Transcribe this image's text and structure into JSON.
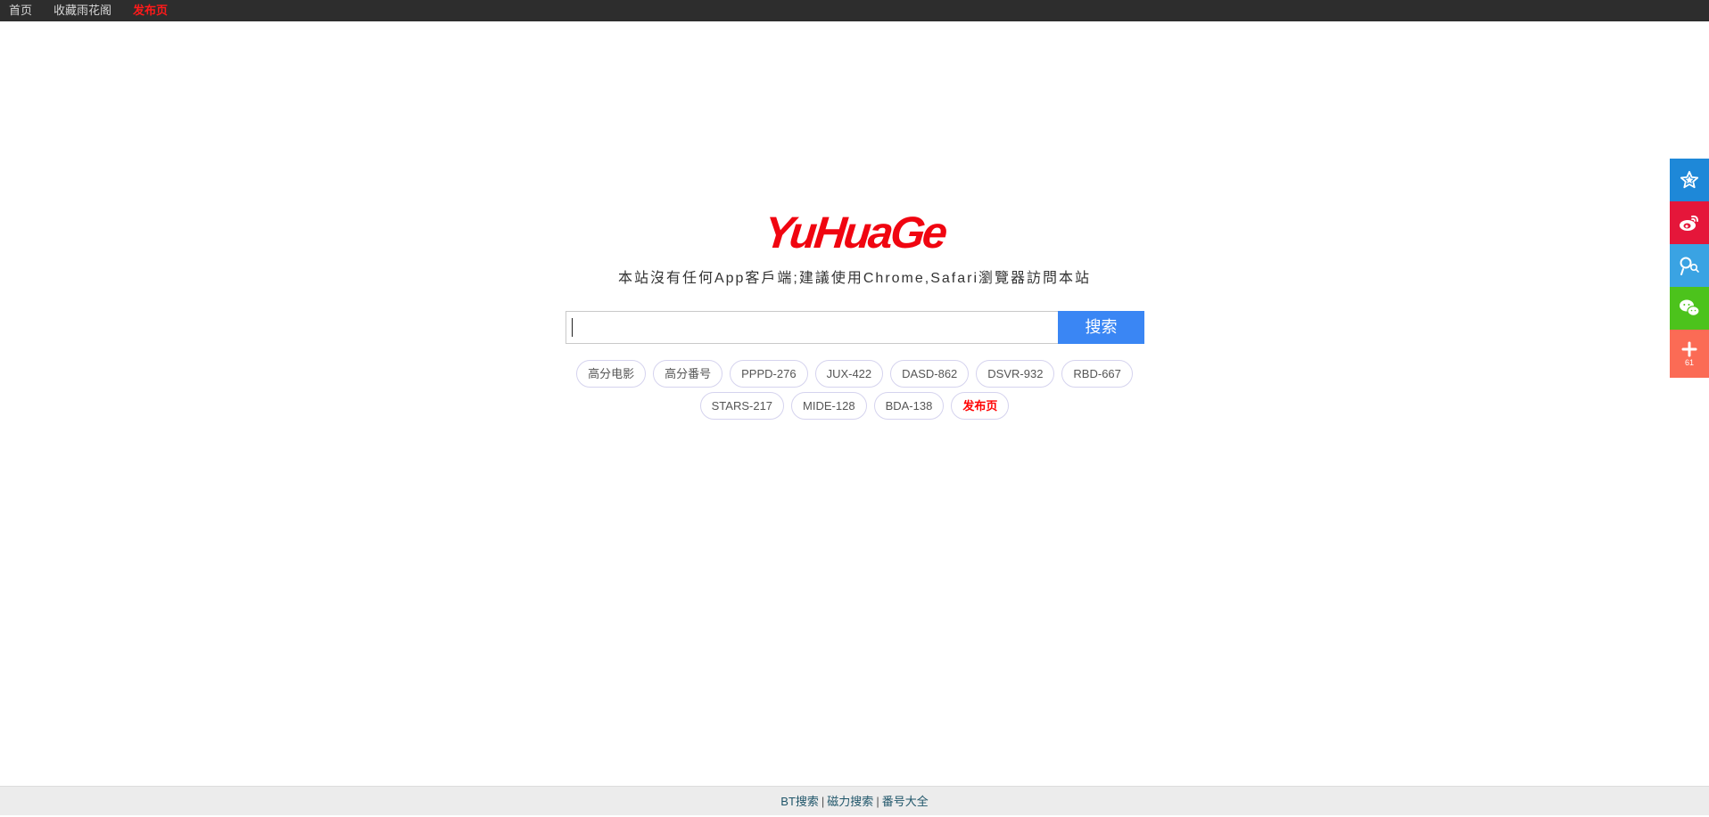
{
  "nav": {
    "home": "首页",
    "bookmark": "收藏雨花阁",
    "publish": "发布页"
  },
  "logo": "YuHuaGe",
  "tagline": "本站沒有任何App客戶端;建議使用Chrome,Safari瀏覽器訪問本站",
  "search": {
    "value": "",
    "placeholder": "",
    "button": "搜索"
  },
  "tags_row1": [
    "高分电影",
    "高分番号",
    "PPPD-276",
    "JUX-422",
    "DASD-862",
    "DSVR-932",
    "RBD-667"
  ],
  "tags_row2": [
    "STARS-217",
    "MIDE-128",
    "BDA-138",
    "发布页"
  ],
  "share": {
    "count": "61",
    "icons": [
      "star-icon",
      "weibo-icon",
      "qq-zone-icon",
      "wechat-icon",
      "plus-icon"
    ],
    "colors": [
      "#1e88d8",
      "#e5163a",
      "#3aa3e3",
      "#4cc31c",
      "#fb6b55"
    ]
  },
  "footer": {
    "links": [
      "BT搜索",
      "磁力搜索",
      "番号大全"
    ],
    "separator": "|"
  },
  "colors": {
    "brand_red": "#f00510",
    "search_blue": "#3a86f4",
    "topbar": "#2d2d2d"
  }
}
